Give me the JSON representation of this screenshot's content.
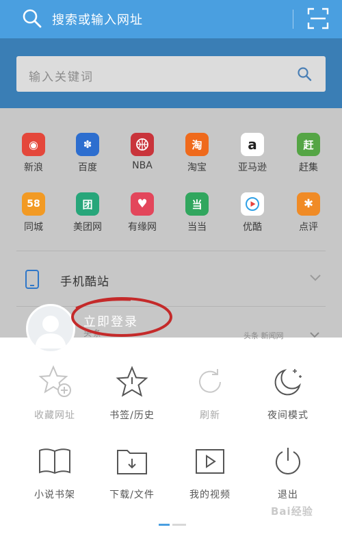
{
  "topbar": {
    "search_text": "搜索或输入网址"
  },
  "keyword_box": {
    "placeholder": "输入关键词"
  },
  "sites_row1": [
    {
      "label": "新浪",
      "color": "#e4473b",
      "glyph": "◉"
    },
    {
      "label": "百度",
      "color": "#2d6ecf",
      "glyph": "🐾"
    },
    {
      "label": "NBA",
      "color": "#c9343b",
      "glyph": "⛹"
    },
    {
      "label": "淘宝",
      "color": "#ef6a1c",
      "glyph": "淘"
    },
    {
      "label": "亚马逊",
      "color": "#ffffff",
      "glyph": "a"
    },
    {
      "label": "赶集",
      "color": "#55a545",
      "glyph": "赶"
    }
  ],
  "sites_row2": [
    {
      "label": "同城",
      "color": "#f29a24",
      "glyph": "58"
    },
    {
      "label": "美团网",
      "color": "#27a67a",
      "glyph": "团"
    },
    {
      "label": "有缘网",
      "color": "#e3465b",
      "glyph": "♥"
    },
    {
      "label": "当当",
      "color": "#31a65e",
      "glyph": "当"
    },
    {
      "label": "优酷",
      "color": "#ffffff",
      "glyph": "▶"
    },
    {
      "label": "点评",
      "color": "#f08b26",
      "glyph": "✱"
    }
  ],
  "mobile_site": {
    "label": "手机酷站"
  },
  "faint_row": {
    "left_text": "头条",
    "right_text": "头条 新闻网"
  },
  "login": {
    "label": "立即登录"
  },
  "menu_row1": [
    {
      "label": "收藏网址",
      "icon": "star-plus-icon"
    },
    {
      "label": "书签/历史",
      "icon": "star-outline-icon"
    },
    {
      "label": "刷新",
      "icon": "refresh-icon"
    },
    {
      "label": "夜间模式",
      "icon": "moon-icon"
    }
  ],
  "menu_row2": [
    {
      "label": "小说书架",
      "icon": "book-icon"
    },
    {
      "label": "下载/文件",
      "icon": "download-folder-icon"
    },
    {
      "label": "我的视频",
      "icon": "video-icon"
    },
    {
      "label": "退出",
      "icon": "power-icon"
    }
  ],
  "watermark": {
    "text": "Bai经验"
  },
  "colors": {
    "topbar": "#4a9fe0",
    "banner": "#3a7eb5",
    "accent": "#4a9fe0",
    "annotation": "#c42a2a"
  }
}
